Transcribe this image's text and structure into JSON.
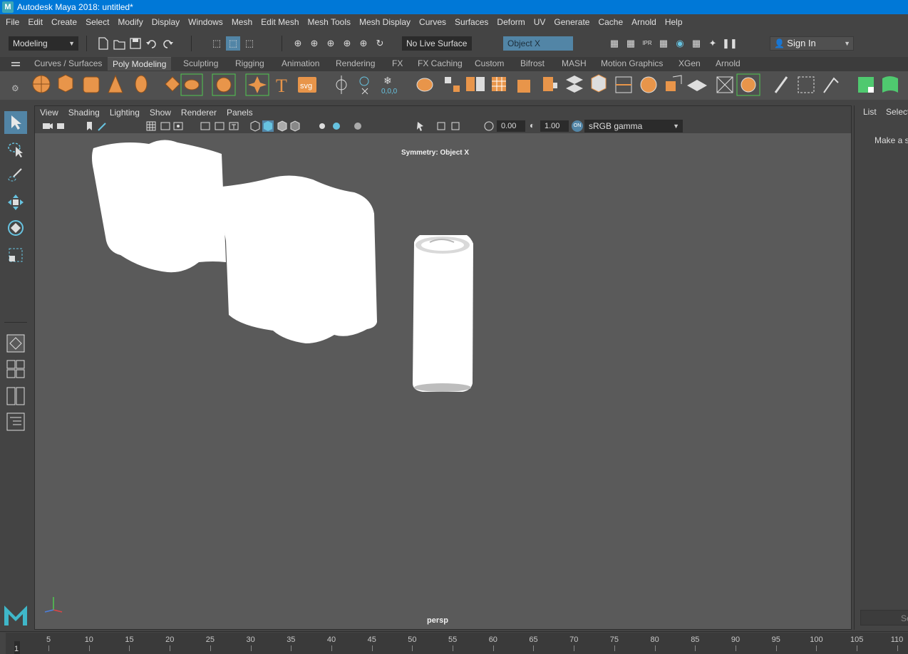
{
  "window": {
    "title": "Autodesk Maya 2018: untitled*",
    "logo_letter": "M"
  },
  "menus": [
    "File",
    "Edit",
    "Create",
    "Select",
    "Modify",
    "Display",
    "Windows",
    "Mesh",
    "Edit Mesh",
    "Mesh Tools",
    "Mesh Display",
    "Curves",
    "Surfaces",
    "Deform",
    "UV",
    "Generate",
    "Cache",
    "Arnold",
    "Help"
  ],
  "statusline": {
    "menu_set": "Modeling",
    "live_surface": "No Live Surface",
    "symmetry": "Object X",
    "sign_in": "Sign In"
  },
  "shelf_tabs": [
    {
      "label": "Curves / Surfaces",
      "active": false
    },
    {
      "label": "Poly Modeling",
      "active": true
    },
    {
      "label": "Sculpting",
      "active": false
    },
    {
      "label": "Rigging",
      "active": false
    },
    {
      "label": "Animation",
      "active": false
    },
    {
      "label": "Rendering",
      "active": false
    },
    {
      "label": "FX",
      "active": false
    },
    {
      "label": "FX Caching",
      "active": false
    },
    {
      "label": "Custom",
      "active": false
    },
    {
      "label": "Bifrost",
      "active": false
    },
    {
      "label": "MASH",
      "active": false
    },
    {
      "label": "Motion Graphics",
      "active": false
    },
    {
      "label": "XGen",
      "active": false
    },
    {
      "label": "Arnold",
      "active": false
    }
  ],
  "shelf_text_icons": {
    "text": "T",
    "svg": "svg",
    "coords": "0,0,0"
  },
  "viewport": {
    "menus": [
      "View",
      "Shading",
      "Lighting",
      "Show",
      "Renderer",
      "Panels"
    ],
    "exposure": "0.00",
    "gamma": "1.00",
    "color_space": "sRGB gamma",
    "symmetry_label": "Symmetry: Object X",
    "camera_label": "persp"
  },
  "right_panel": {
    "tabs": [
      "List",
      "Select"
    ],
    "hint": "Make a se",
    "search": "Se"
  },
  "timeline": {
    "ticks": [
      "5",
      "10",
      "15",
      "20",
      "25",
      "30",
      "35",
      "40",
      "45",
      "50",
      "55",
      "60",
      "65",
      "70",
      "75",
      "80",
      "85",
      "90",
      "95",
      "100",
      "105",
      "110"
    ],
    "current_frame": "1"
  },
  "colors": {
    "titlebar": "#0078d7",
    "ui_bg": "#444444",
    "viewport_bg": "#5a5a5a",
    "shelf_orange": "#e8954a",
    "highlight_blue": "#5285a6",
    "shelf_green": "#4fc94f"
  }
}
